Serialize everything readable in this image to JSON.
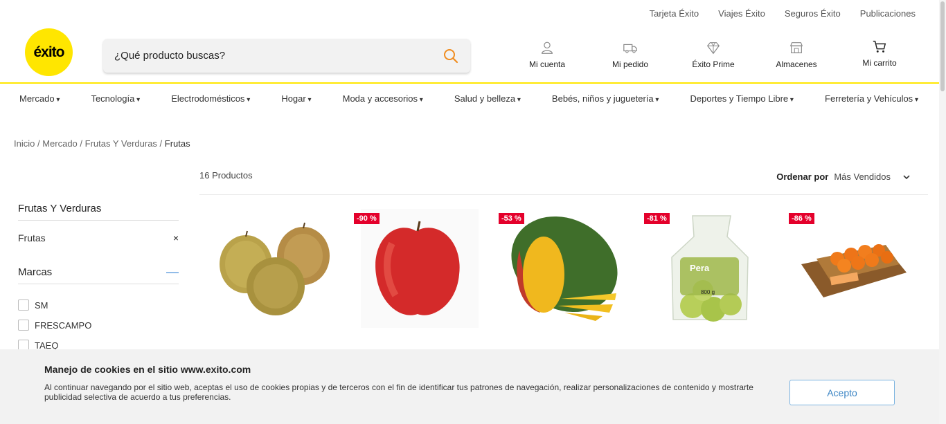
{
  "top_links": [
    "Tarjeta Éxito",
    "Viajes Éxito",
    "Seguros Éxito",
    "Publicaciones"
  ],
  "logo_text": "éxito",
  "search": {
    "placeholder": "¿Qué producto buscas?"
  },
  "header_actions": {
    "account": "Mi cuenta",
    "order": "Mi pedido",
    "prime": "Éxito Prime",
    "stores": "Almacenes",
    "cart": "Mi carrito"
  },
  "categories": [
    "Mercado",
    "Tecnología",
    "Electrodomésticos",
    "Hogar",
    "Moda y accesorios",
    "Salud y belleza",
    "Bebés, niños y juguetería",
    "Deportes y Tiempo Libre",
    "Ferretería y Vehículos"
  ],
  "breadcrumb": {
    "home": "Inicio",
    "sep": " / ",
    "l1": "Mercado",
    "l2": "Frutas Y Verduras",
    "current": "Frutas"
  },
  "results": {
    "count": "16 Productos",
    "order_label": "Ordenar por",
    "order_value": "Más Vendidos"
  },
  "sidebar": {
    "title": "Frutas Y Verduras",
    "selected": "Frutas",
    "remove": "×",
    "brands_title": "Marcas",
    "brands": [
      "SM",
      "FRESCAMPO",
      "TAEQ"
    ]
  },
  "products": [
    {
      "name": "apples",
      "badge": ""
    },
    {
      "name": "red-apple",
      "badge": "-90 %"
    },
    {
      "name": "mango",
      "badge": "-53 %"
    },
    {
      "name": "pears-bag",
      "badge": "-81 %"
    },
    {
      "name": "tangerines",
      "badge": "-86 %"
    }
  ],
  "pear_bag_label": "Pera",
  "pear_bag_weight": "800 g",
  "cookie": {
    "title": "Manejo de cookies en el sitio www.exito.com",
    "text": "Al continuar navegando por el sitio web, aceptas el uso de cookies propias y de terceros con el fin de identificar tus patrones de navegación, realizar personalizaciones de contenido y mostrarte publicidad selectiva de acuerdo a tus preferencias.",
    "accept": "Acepto"
  },
  "colors": {
    "brand_yellow": "#ffe600",
    "discount_red": "#e4002b",
    "search_icon": "#f08c1e",
    "accept_blue": "#3a84c4"
  }
}
